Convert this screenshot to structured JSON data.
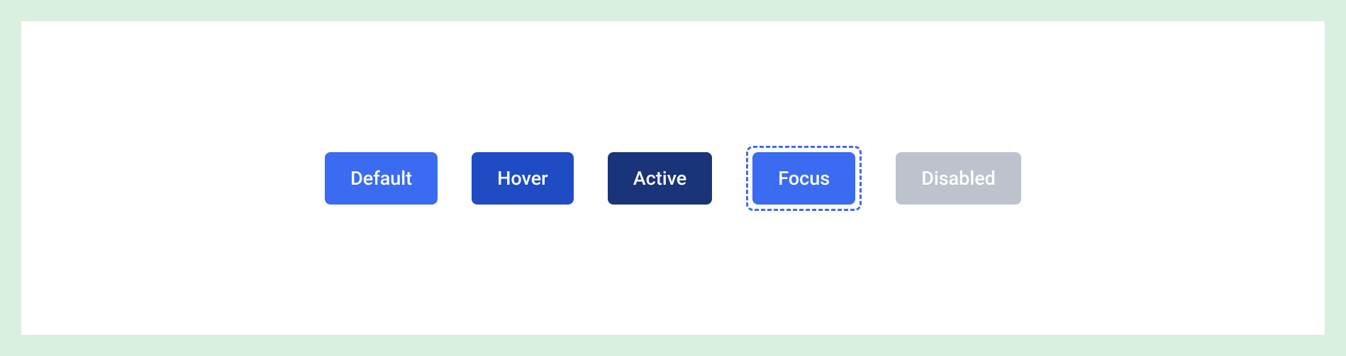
{
  "buttons": {
    "default": {
      "label": "Default"
    },
    "hover": {
      "label": "Hover"
    },
    "active": {
      "label": "Active"
    },
    "focus": {
      "label": "Focus"
    },
    "disabled": {
      "label": "Disabled"
    }
  },
  "colors": {
    "page_bg": "#d9f0e0",
    "panel_bg": "#ffffff",
    "default": "#3b6bf0",
    "hover": "#1f4cc4",
    "active": "#1a347a",
    "focus_outline": "#3b6bf0",
    "disabled": "#bdc2cc",
    "text": "#ffffff"
  }
}
